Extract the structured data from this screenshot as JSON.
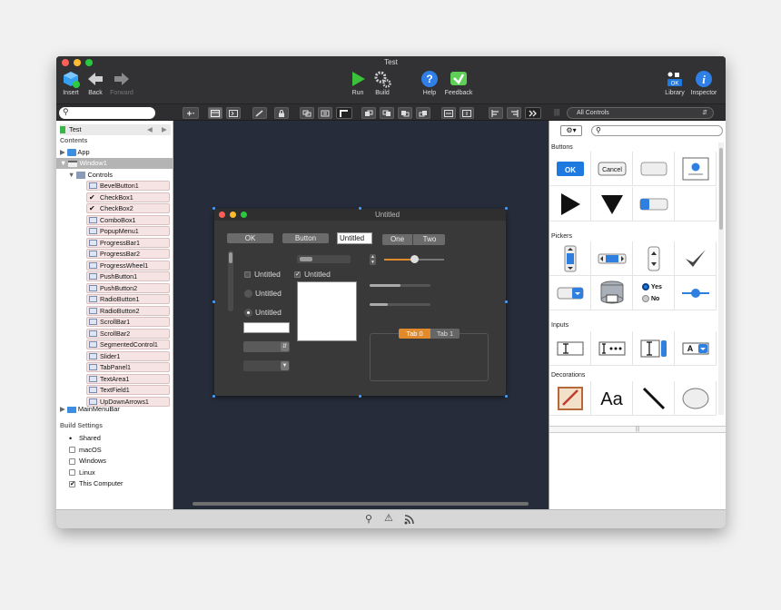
{
  "window": {
    "title": "Test"
  },
  "toolbar": {
    "insert": "Insert",
    "back": "Back",
    "forward": "Forward",
    "run": "Run",
    "build": "Build",
    "help": "Help",
    "feedback": "Feedback",
    "library": "Library",
    "inspector": "Inspector"
  },
  "toolbar2": {
    "library_filter": "All Controls"
  },
  "navigator": {
    "project": "Test",
    "contents_heading": "Contents",
    "app": "App",
    "window1": "Window1",
    "controls": "Controls",
    "items": [
      "BevelButton1",
      "CheckBox1",
      "CheckBox2",
      "ComboBox1",
      "PopupMenu1",
      "ProgressBar1",
      "ProgressBar2",
      "ProgressWheel1",
      "PushButton1",
      "PushButton2",
      "RadioButton1",
      "RadioButton2",
      "ScrollBar1",
      "ScrollBar2",
      "SegmentedControl1",
      "Slider1",
      "TabPanel1",
      "TextArea1",
      "TextField1",
      "UpDownArrows1"
    ],
    "menubar": "MainMenuBar",
    "build_heading": "Build Settings",
    "build_targets": [
      {
        "label": "Shared",
        "state": "radio"
      },
      {
        "label": "macOS",
        "state": "off"
      },
      {
        "label": "Windows",
        "state": "off"
      },
      {
        "label": "Linux",
        "state": "off"
      },
      {
        "label": "This Computer",
        "state": "on"
      }
    ]
  },
  "designer": {
    "title": "Untitled",
    "bevel_label": "OK",
    "button_label": "Button",
    "textfield_value": "Untitled",
    "seg_one": "One",
    "seg_two": "Two",
    "checkbox1": "Untitled",
    "checkbox2": "Untitled",
    "radio1": "Untitled",
    "radio2": "Untitled",
    "tab0": "Tab 0",
    "tab1": "Tab 1",
    "slider_value": 0.5,
    "progress1": 0.5,
    "progress2": 0.3
  },
  "library": {
    "sections": {
      "buttons": "Buttons",
      "pickers": "Pickers",
      "inputs": "Inputs",
      "decorations": "Decorations"
    },
    "ok": "OK",
    "cancel": "Cancel",
    "yes": "Yes",
    "no": "No",
    "aa": "Aa",
    "a": "A"
  },
  "colors": {
    "accent": "#1f8bf5",
    "tab_active": "#e08a2c",
    "selection_pink": "#f6e4e4"
  }
}
